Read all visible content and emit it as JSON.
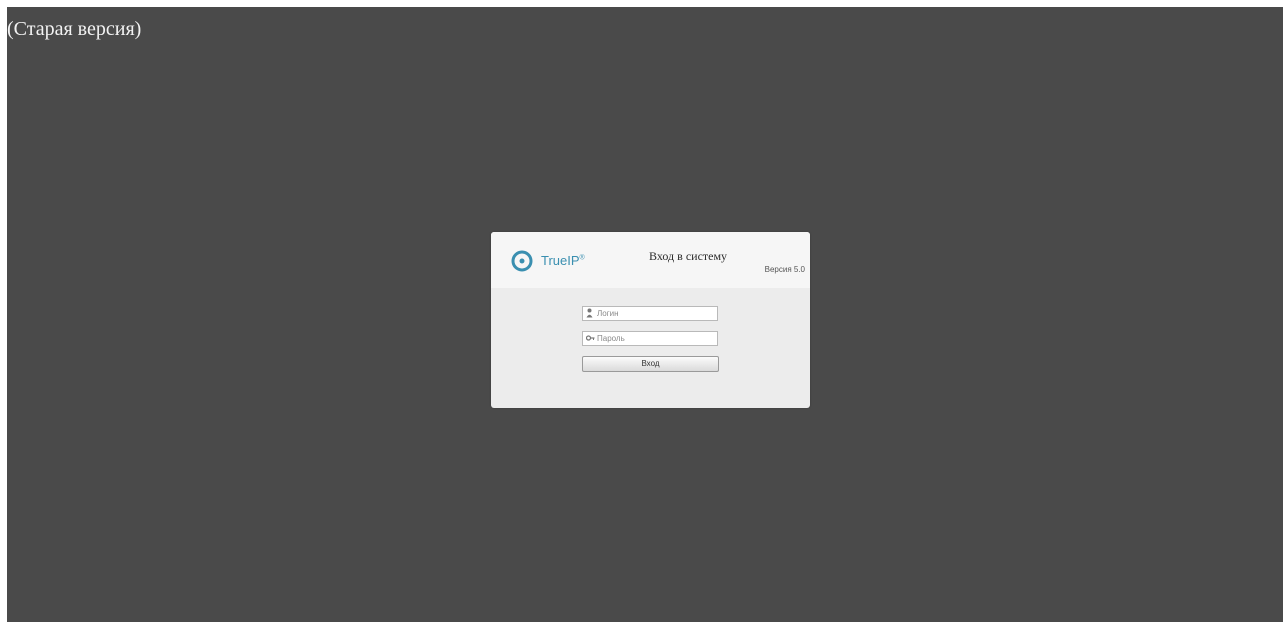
{
  "banner": {
    "old_version_text": "(Старая версия)"
  },
  "login_panel": {
    "logo_text": "TrueIP",
    "logo_trademark": "®",
    "system_title": "Вход в систему",
    "version": "Версия 5.0",
    "username_placeholder": "Логин",
    "password_placeholder": "Пароль",
    "submit_label": "Вход",
    "username_icon": "user-icon",
    "password_icon": "key-icon"
  },
  "colors": {
    "background": "#4a4a4a",
    "panel": "#ececec",
    "logo_accent": "#3a8fb0"
  }
}
